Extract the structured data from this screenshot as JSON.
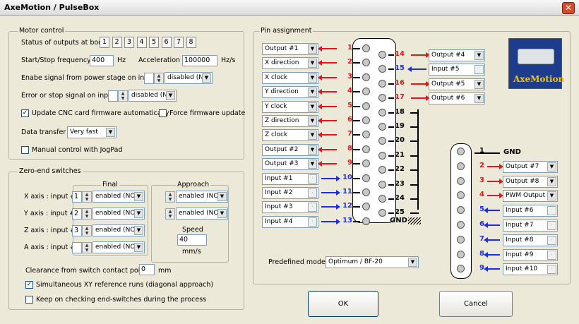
{
  "window": {
    "title": "AxeMotion / PulseBox",
    "close_glyph": "✕"
  },
  "motor_control": {
    "title": "Motor control",
    "boot_label": "Status of outputs at boot :",
    "boot_buttons": [
      "1",
      "2",
      "3",
      "4",
      "5",
      "6",
      "7",
      "8"
    ],
    "freq_label": "Start/Stop frequency :",
    "freq_value": "400",
    "freq_unit": "Hz",
    "accel_label": "Acceleration :",
    "accel_value": "100000",
    "accel_unit": "Hz/s",
    "enable_label": "Enabe signal from power stage on input #",
    "enable_value": "disabled (NC",
    "error_label": "Error or stop signal on input #",
    "error_value": "disabled (NC",
    "update_label": "Update CNC card firmware automatically",
    "update_checked": true,
    "force_label": "Force firmware update",
    "force_checked": false,
    "transfer_label": "Data transfer :",
    "transfer_value": "Very fast",
    "jogpad_label": "Manual control with JogPad",
    "jogpad_checked": false
  },
  "zero_end": {
    "title": "Zero-end switches",
    "final_title": "Final",
    "approach_title": "Approach",
    "axes": [
      {
        "label": "X axis :  input #",
        "input": "1",
        "final": "enabled (NO)",
        "approach": "enabled (NO)"
      },
      {
        "label": "Y axis :  input #",
        "input": "2",
        "final": "enabled (NO)",
        "approach": "enabled (NO)"
      },
      {
        "label": "Z axis :  input #",
        "input": "3",
        "final": "enabled (NO)"
      },
      {
        "label": "A axis :  input #",
        "input": "",
        "final": "enabled (NO)"
      }
    ],
    "speed_label": "Speed",
    "speed_value": "40",
    "speed_unit": "mm/s",
    "clearance_label": "Clearance from switch contact point :",
    "clearance_value": "0",
    "clearance_unit": "mm",
    "simul_label": "Simultaneous XY reference runs (diagonal approach)",
    "simul_checked": true,
    "keep_label": "Keep on checking end-switches during the process",
    "keep_checked": false
  },
  "pin_assignment": {
    "title": "Pin assignment",
    "left_pins": [
      {
        "num": "1",
        "value": "Output #1",
        "dir": "out"
      },
      {
        "num": "2",
        "value": "X direction",
        "dir": "out"
      },
      {
        "num": "3",
        "value": "X clock",
        "dir": "out"
      },
      {
        "num": "4",
        "value": "Y direction",
        "dir": "out"
      },
      {
        "num": "5",
        "value": "Y clock",
        "dir": "out"
      },
      {
        "num": "6",
        "value": "Z direction",
        "dir": "out"
      },
      {
        "num": "7",
        "value": "Z clock",
        "dir": "out"
      },
      {
        "num": "8",
        "value": "Output #2",
        "dir": "out"
      },
      {
        "num": "9",
        "value": "Output #3",
        "dir": "out"
      },
      {
        "num": "10",
        "value": "Input #1",
        "dir": "in"
      },
      {
        "num": "11",
        "value": "Input #2",
        "dir": "in"
      },
      {
        "num": "12",
        "value": "Input #3",
        "dir": "in"
      },
      {
        "num": "13",
        "value": "Input #4",
        "dir": "in"
      }
    ],
    "right_pins": [
      {
        "num": "14",
        "value": "Output #4",
        "dir": "out"
      },
      {
        "num": "15",
        "value": "Input #5",
        "dir": "in"
      },
      {
        "num": "16",
        "value": "Output #5",
        "dir": "out"
      },
      {
        "num": "17",
        "value": "Output #6",
        "dir": "out"
      },
      {
        "num": "18",
        "value": "",
        "dir": "gnd"
      },
      {
        "num": "19",
        "value": "",
        "dir": "gnd"
      },
      {
        "num": "20",
        "value": "",
        "dir": "gnd"
      },
      {
        "num": "21",
        "value": "",
        "dir": "gnd"
      },
      {
        "num": "22",
        "value": "",
        "dir": "gnd"
      },
      {
        "num": "23",
        "value": "",
        "dir": "gnd"
      },
      {
        "num": "24",
        "value": "",
        "dir": "gnd"
      },
      {
        "num": "25",
        "value": "",
        "dir": "gnd"
      }
    ],
    "gnd_label": "GND",
    "connector2_pins": [
      {
        "num": "1",
        "value": "",
        "dir": "gnd"
      },
      {
        "num": "2",
        "value": "Output #7",
        "dir": "out"
      },
      {
        "num": "3",
        "value": "Output #8",
        "dir": "out"
      },
      {
        "num": "4",
        "value": "PWM Output",
        "dir": "out"
      },
      {
        "num": "5",
        "value": "Input #6",
        "dir": "in"
      },
      {
        "num": "6",
        "value": "Input #7",
        "dir": "in"
      },
      {
        "num": "7",
        "value": "Input #8",
        "dir": "in"
      },
      {
        "num": "8",
        "value": "Input #9",
        "dir": "in"
      },
      {
        "num": "9",
        "value": "Input #10",
        "dir": "in"
      }
    ],
    "model_label": "Predefined model :",
    "model_value": "Optimum / BF-20",
    "logo_text": "AxeMotion"
  },
  "buttons": {
    "ok": "OK",
    "cancel": "Cancel"
  },
  "colors": {
    "output_arrow": "#e8131b",
    "input_arrow": "#1d2de6",
    "logo_bg": "#1d3d8c"
  },
  "icons": {
    "dropdown": "▼",
    "spin_up": "▲",
    "spin_down": "▼",
    "check": "✓"
  }
}
